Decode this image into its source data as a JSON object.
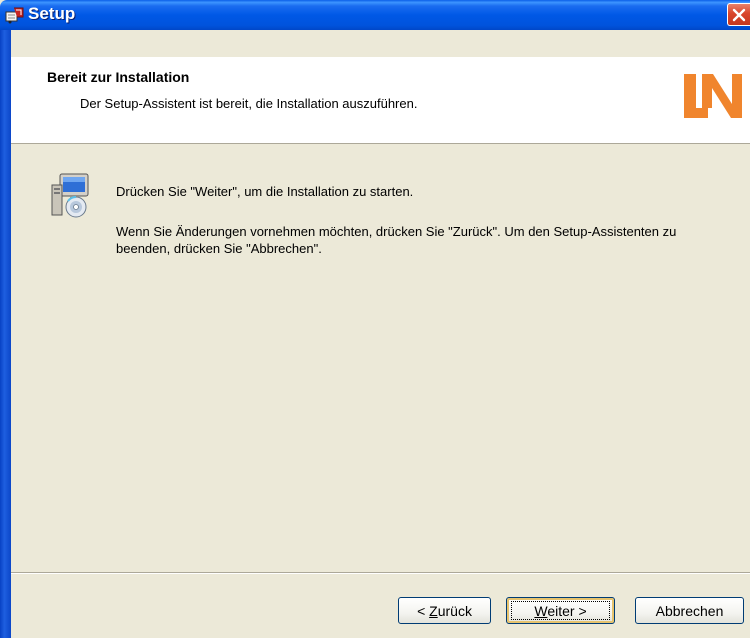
{
  "window": {
    "title": "Setup"
  },
  "header": {
    "title": "Bereit zur Installation",
    "subtitle": "Der Setup-Assistent ist bereit, die Installation auszuführen.",
    "logo_text": "LN"
  },
  "body": {
    "message1": "Drücken Sie \"Weiter\", um die Installation zu starten.",
    "message2": "Wenn Sie Änderungen vornehmen möchten, drücken Sie \"Zurück\". Um den Setup-Assistenten zu beenden, drücken Sie \"Abbrechen\"."
  },
  "buttons": {
    "back": {
      "prefix": "< ",
      "accel": "Z",
      "rest": "urück"
    },
    "next": {
      "accel": "W",
      "rest": "eiter >"
    },
    "cancel": "Abbrechen"
  },
  "colors": {
    "titlebar": "#0058E6",
    "background": "#ECE9D8",
    "logo": "#F0852D",
    "close_button": "#D9452B"
  },
  "icons": {
    "app": "setup-app-icon",
    "close": "close-icon",
    "body": "setup-installer-icon",
    "logo": "ln-logo"
  }
}
